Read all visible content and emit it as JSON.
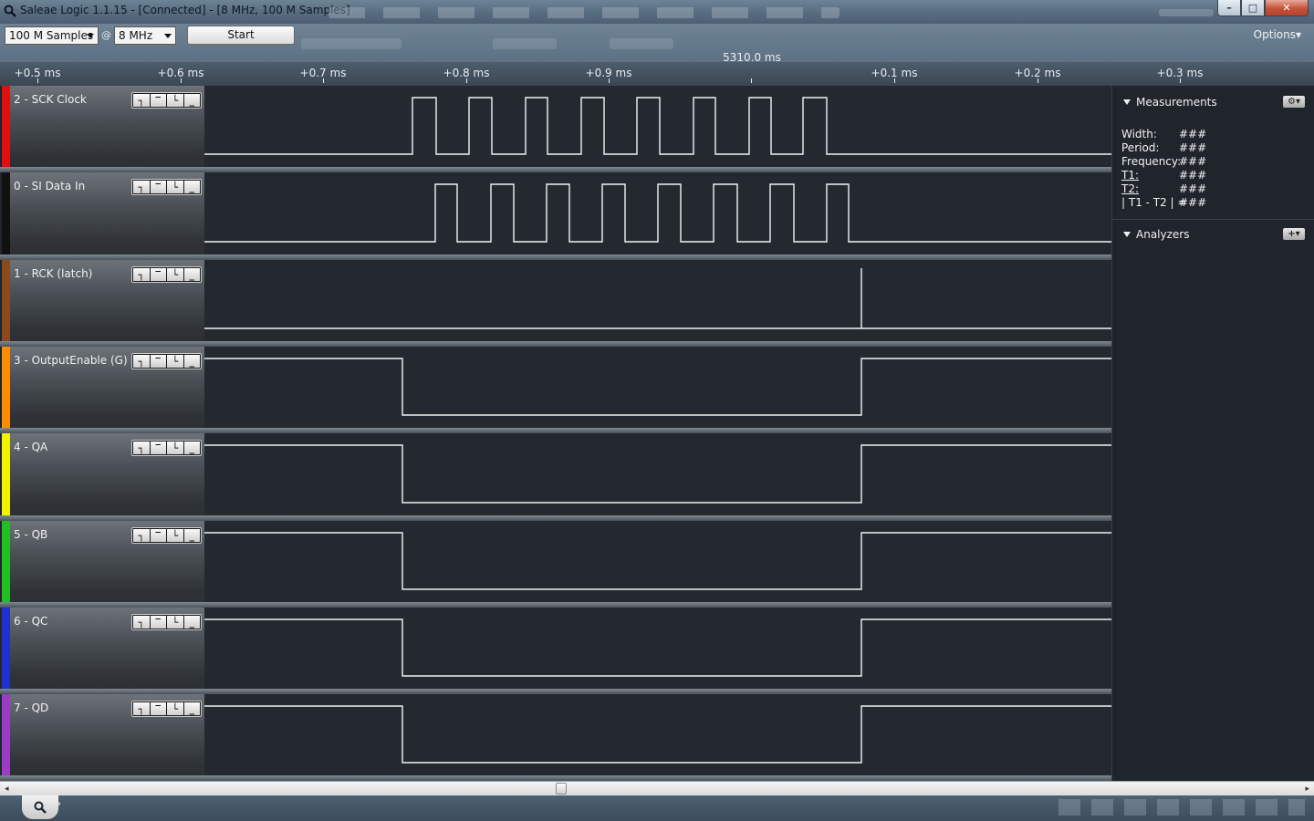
{
  "window": {
    "title": "Saleae Logic 1.1.15 - [Connected] - [8 MHz, 100 M Samples]",
    "minimize": "–",
    "maximize": "□",
    "close": "✕"
  },
  "toolbar": {
    "samples_value": "100 M Samples",
    "at_sign": "@",
    "rate_value": "8 MHz",
    "start_label": "Start",
    "options_label": "Options▾"
  },
  "ruler": {
    "ticks": [
      "+0.5 ms",
      "+0.6 ms",
      "+0.7 ms",
      "+0.8 ms",
      "+0.9 ms",
      "+0.1 ms",
      "+0.2 ms",
      "+0.3 ms"
    ],
    "cursor_time": "5310.0 ms"
  },
  "trigger_icons": [
    "rising-edge-icon",
    "high-level-icon",
    "falling-edge-icon",
    "low-level-icon"
  ],
  "trigger_glyphs": [
    "┐",
    "‾",
    "└",
    "_"
  ],
  "channels": [
    {
      "label": "2 - SCK Clock",
      "color": "#e01010",
      "signal": "sck"
    },
    {
      "label": "0 - SI Data In",
      "color": "#111111",
      "signal": "si"
    },
    {
      "label": "1 - RCK (latch)",
      "color": "#8a4a1c",
      "signal": "rck"
    },
    {
      "label": "3 - OutputEnable (G)",
      "color": "#ff8c00",
      "signal": "oe"
    },
    {
      "label": "4 - QA",
      "color": "#f2f200",
      "signal": "q"
    },
    {
      "label": "5 - QB",
      "color": "#20c020",
      "signal": "q"
    },
    {
      "label": "6 - QC",
      "color": "#2030d0",
      "signal": "q"
    },
    {
      "label": "7 - QD",
      "color": "#9a3cc8",
      "signal": "q"
    }
  ],
  "measurements": {
    "header": "Measurements",
    "rows": [
      {
        "key": "Width:",
        "value": "###",
        "underline": false
      },
      {
        "key": "Period:",
        "value": "###",
        "underline": false
      },
      {
        "key": "Frequency:",
        "value": "###",
        "underline": false
      },
      {
        "key": "T1:",
        "value": "###",
        "underline": true
      },
      {
        "key": "T2:",
        "value": "###",
        "underline": true
      },
      {
        "key": "| T1 - T2 | =",
        "value": "###",
        "underline": false
      }
    ]
  },
  "analyzers": {
    "header": "Analyzers"
  },
  "settings_button": "⚙▾",
  "add_button": "+▾",
  "scroll": {
    "left": "◂",
    "right": "▸"
  },
  "status": {
    "expand": "›"
  }
}
